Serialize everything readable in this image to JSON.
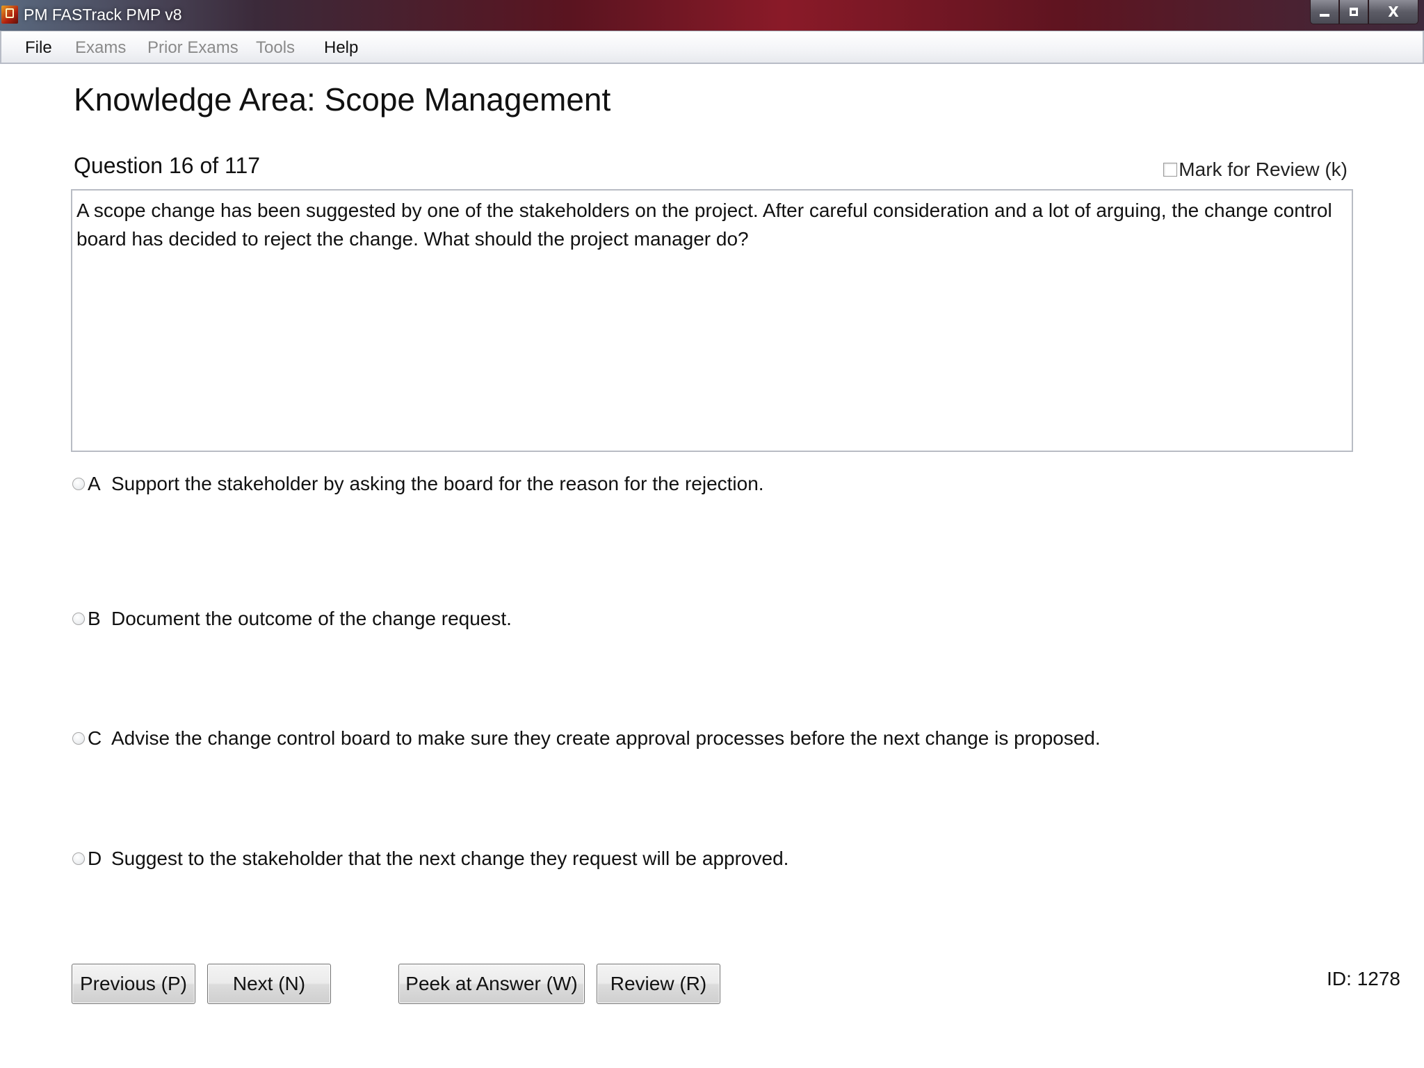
{
  "window": {
    "title": "PM FASTrack PMP v8",
    "close_glyph": "X"
  },
  "menu": {
    "file": "File",
    "exams": "Exams",
    "prior_exams": "Prior Exams",
    "tools": "Tools",
    "help": "Help"
  },
  "exam": {
    "knowledge_area": "Knowledge Area: Scope Management",
    "question_counter": "Question 16 of 117",
    "mark_for_review": "Mark for Review (k)",
    "question_text": "A scope change has been suggested by one of the stakeholders on the project. After careful consideration and a lot of arguing, the change control board has decided to reject the change. What should the project manager do?",
    "options": [
      {
        "letter": "A",
        "text": "Support the stakeholder by asking the board for the reason for the rejection."
      },
      {
        "letter": "B",
        "text": "Document the outcome of the change request."
      },
      {
        "letter": "C",
        "text": "Advise the change control board to make sure they create approval processes before the next change is proposed."
      },
      {
        "letter": "D",
        "text": "Suggest to the stakeholder that the next change they request will be approved."
      }
    ]
  },
  "buttons": {
    "previous": "Previous (P)",
    "next": "Next (N)",
    "peek": "Peek at Answer (W)",
    "review": "Review (R)"
  },
  "id_label": "ID: 1278"
}
